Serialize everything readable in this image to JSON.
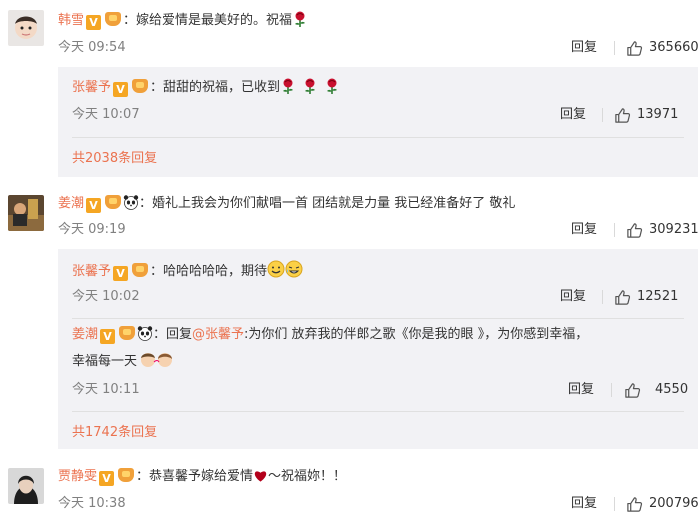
{
  "c1": {
    "name": "韩雪",
    "text": "：嫁给爱情是最美好的。祝福",
    "time": "今天 09:54",
    "reply": "回复",
    "likes": "365660",
    "r1": {
      "name": "张馨予",
      "text": "：甜甜的祝福，已收到",
      "time": "今天 10:07",
      "reply": "回复",
      "likes": "13971"
    },
    "more": "共2038条回复"
  },
  "c2": {
    "name": "姜潮",
    "text": "：婚礼上我会为你们献唱一首 团结就是力量 我已经准备好了 敬礼",
    "time": "今天 09:19",
    "reply": "回复",
    "likes": "309231",
    "r1": {
      "name": "张馨予",
      "text": "：哈哈哈哈哈，期待",
      "time": "今天 10:02",
      "reply": "回复",
      "likes": "12521"
    },
    "r2": {
      "name": "姜潮",
      "text_pre": "：回复",
      "mention": "@张馨予",
      "text_post": ":为你们 放弃我的伴郎之歌《你是我的眼 》，为你感到幸福，",
      "text_line2": "幸福每一天",
      "time": "今天 10:11",
      "reply": "回复",
      "likes": "4550"
    },
    "more": "共1742条回复"
  },
  "c3": {
    "name": "贾静雯",
    "text_pre": "：恭喜馨予嫁给爱情",
    "text_post": "～祝福妳！！",
    "time": "今天 10:38",
    "reply": "回复",
    "likes": "200796"
  },
  "colors": {
    "name": "#eb7350",
    "panel": "#f2f2f5",
    "rose": "#c8102e",
    "heart": "#b3001b"
  }
}
